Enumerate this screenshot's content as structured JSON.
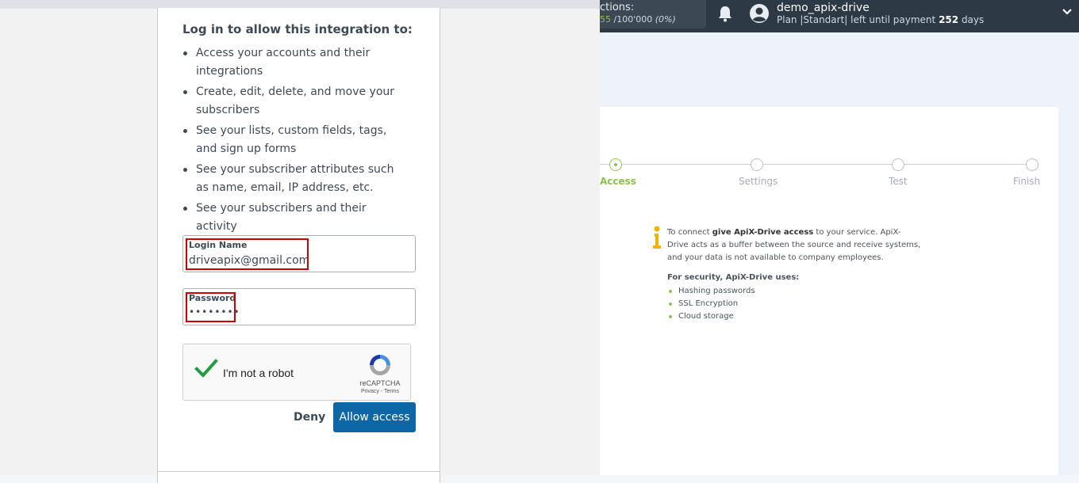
{
  "topbar": {
    "connections_title": "ctions:",
    "connections_used": "55",
    "connections_total": " /100'000",
    "connections_pct": "(0%)",
    "user_name": "demo_apix-drive",
    "plan_prefix": "Plan |Standart| left until payment ",
    "plan_days": "252",
    "plan_suffix": " days",
    "icons": [
      "bell-icon",
      "user-avatar-icon",
      "chevron-down-icon"
    ]
  },
  "steps": [
    {
      "label": "Access",
      "active": true
    },
    {
      "label": "Settings",
      "active": false
    },
    {
      "label": "Test",
      "active": false
    },
    {
      "label": "Finish",
      "active": false
    }
  ],
  "info": {
    "text_pre": "To connect ",
    "text_bold": "give ApiX-Drive access",
    "text_post": " to your service. ApiX-Drive acts as a buffer between the source and receive systems, and your data is not available to company employees.",
    "security_title": "For security, ApiX-Drive uses:",
    "security_items": [
      "Hashing passwords",
      "SSL Encryption",
      "Cloud storage"
    ]
  },
  "dialog": {
    "title": "Log in to allow this integration to:",
    "permissions": [
      "Access your accounts and their integrations",
      "Create, edit, delete, and move your subscribers",
      "See your lists, custom fields, tags, and sign up forms",
      "See your subscriber attributes such as name, email, IP address, etc.",
      "See your subscribers and their activity"
    ],
    "login_label": "Login Name",
    "login_value": "driveapix@gmail.com",
    "password_label": "Password",
    "password_value": "••••••••",
    "captcha_label": "I'm not a robot",
    "captcha_brand": "reCAPTCHA",
    "captcha_links": "Privacy - Terms",
    "deny_label": "Deny",
    "allow_label": "Allow access"
  },
  "colors": {
    "accent_green": "#8bc34a",
    "allow_button": "#0d66a6",
    "highlight_red": "#d00000",
    "topbar": "#2d3a45"
  }
}
